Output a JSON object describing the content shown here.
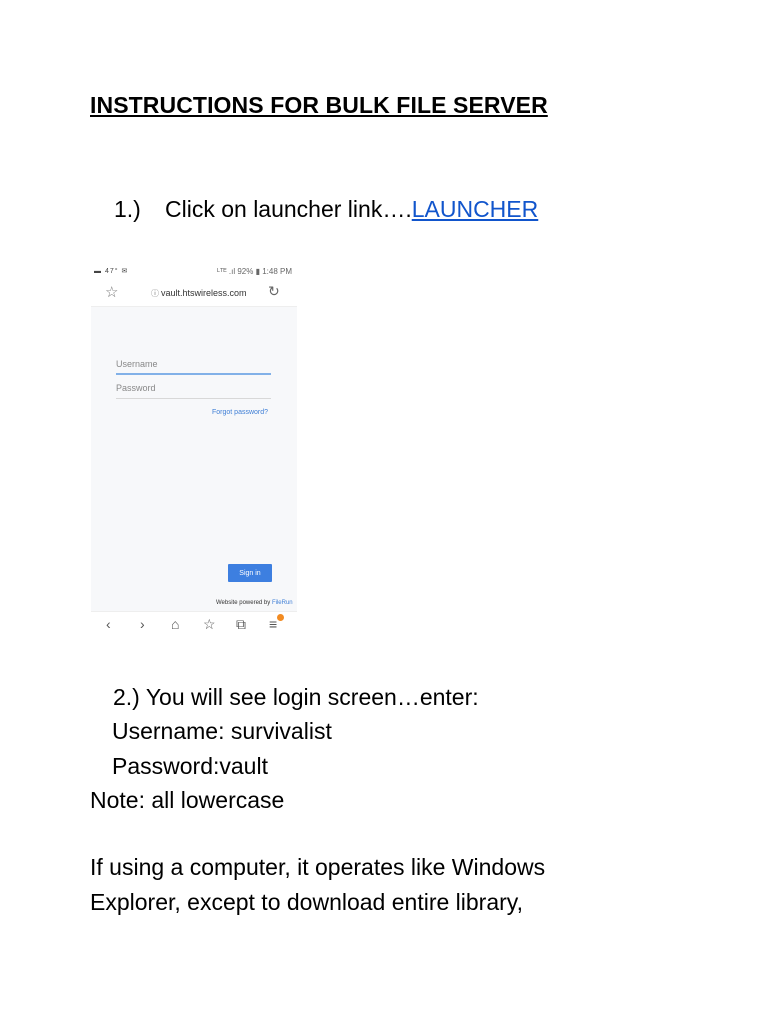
{
  "title": "INSTRUCTIONS FOR BULK FILE SERVER",
  "step1": {
    "number": "1.)",
    "text": "Click on launcher link….",
    "link": "LAUNCHER"
  },
  "screenshot": {
    "status_left": "▬ 47° ✉",
    "status_right": "ᴸᵀᴱ .ıl 92% ▮ 1:48 PM",
    "url": "vault.htswireless.com",
    "username_placeholder": "Username",
    "password_placeholder": "Password",
    "forgot_password": "Forgot password?",
    "sign_in": "Sign in",
    "powered_by": "Website powered by",
    "powered_brand": "FileRun",
    "icons": {
      "star": "☆",
      "info": "ⓘ",
      "reload": "↻",
      "back": "‹",
      "forward": "›",
      "home": "⌂",
      "bookmarks": "☆",
      "tabs": "⧉",
      "menu": "≡"
    }
  },
  "step2": {
    "line1": "2.)  You will see login screen…enter:",
    "line2": "Username: survivalist",
    "line3": "Password:vault"
  },
  "note": "Note: all lowercase",
  "paragraph": {
    "line1": "If using a computer, it operates like Windows",
    "line2": "Explorer, except to download entire library,"
  }
}
